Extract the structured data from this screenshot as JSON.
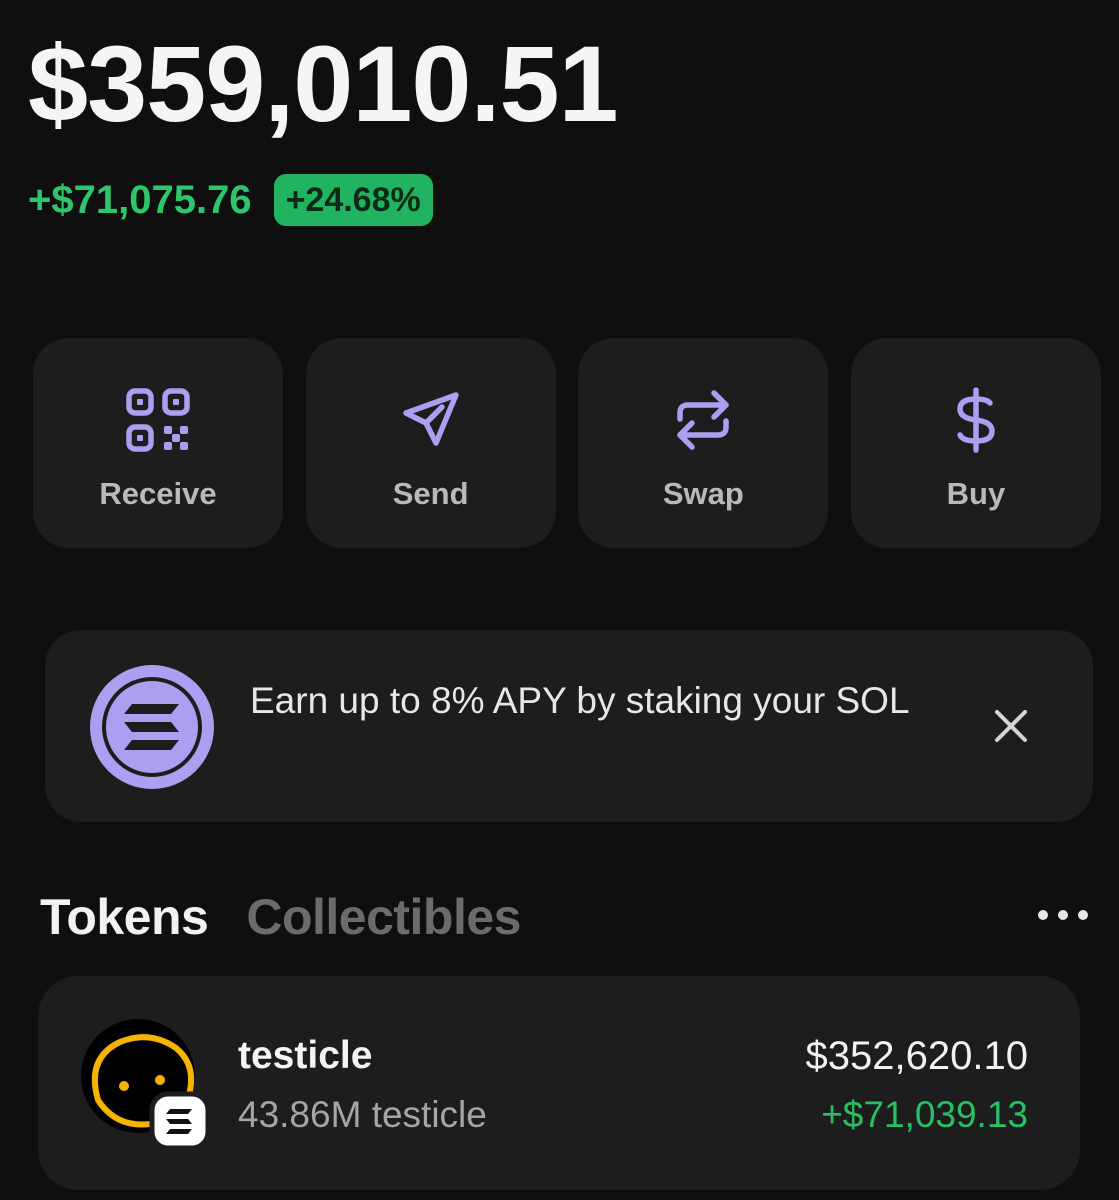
{
  "balance": {
    "total": "$359,010.51",
    "change_amount": "+$71,075.76",
    "change_percent": "+24.68%"
  },
  "actions": [
    {
      "label": "Receive",
      "icon": "qr-code-icon"
    },
    {
      "label": "Send",
      "icon": "send-icon"
    },
    {
      "label": "Swap",
      "icon": "swap-icon"
    },
    {
      "label": "Buy",
      "icon": "dollar-icon"
    }
  ],
  "promo": {
    "text": "Earn up to 8% APY by staking your SOL",
    "icon": "solana-logo-icon",
    "close_icon": "close-icon"
  },
  "tabs": [
    {
      "label": "Tokens",
      "active": true
    },
    {
      "label": "Collectibles",
      "active": false
    }
  ],
  "more_icon": "more-horizontal-icon",
  "tokens": [
    {
      "name": "testicle",
      "amount": "43.86M testicle",
      "value": "$352,620.10",
      "change": "+$71,039.13",
      "icon": "testicle-token-avatar",
      "badge_icon": "solana-badge-icon"
    }
  ],
  "colors": {
    "accent": "#ab9ff2",
    "positive": "#2ec66b",
    "positive_badge": "#21b35f",
    "card": "#1d1d1d",
    "background": "#0f0f0f"
  }
}
